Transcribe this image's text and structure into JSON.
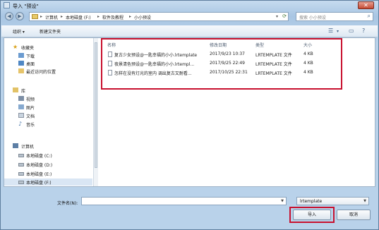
{
  "window": {
    "title": "导入 \"预设\"",
    "close_label": "✕"
  },
  "nav": {
    "back_icon": "back-arrow-icon",
    "forward_icon": "forward-arrow-icon",
    "breadcrumb": [
      "计算机",
      "本地磁盘 (F:)",
      "软件及教程",
      "小小预设"
    ],
    "search_placeholder": "搜索 小小预设"
  },
  "toolbar": {
    "organize_label": "组织 ▾",
    "new_folder_label": "新建文件夹"
  },
  "sidebar": {
    "favorites": {
      "header": "收藏夹",
      "items": [
        "下载",
        "桌面",
        "最近访问的位置"
      ]
    },
    "library": {
      "header": "库",
      "items": [
        "视频",
        "图片",
        "文档",
        "音乐"
      ]
    },
    "computer": {
      "header": "计算机",
      "items": [
        "本地磁盘 (C:)",
        "本地磁盘 (D:)",
        "本地磁盘 (E:)",
        "本地磁盘 (F:)"
      ]
    }
  },
  "file_list": {
    "columns": [
      "名称",
      "修改日期",
      "类型",
      "大小"
    ],
    "rows": [
      {
        "name": "复古少女预设@一匙幸福的小小.lrtemplate",
        "date": "2017/9/23 10:37",
        "type": "LRTEMPLATE 文件",
        "size": "4 KB"
      },
      {
        "name": "夜景清色预设@一匙幸福的小小.lrtempl...",
        "date": "2017/9/25 22:49",
        "type": "LRTEMPLATE 文件",
        "size": "4 KB"
      },
      {
        "name": "怎样在没有灯光的室内 调出复古又耐看...",
        "date": "2017/10/25 22:31",
        "type": "LRTEMPLATE 文件",
        "size": "4 KB"
      }
    ]
  },
  "footer": {
    "filename_label": "文件名(N):",
    "filename_value": "",
    "filetype_value": "lrtemplate",
    "import_label": "导入",
    "cancel_label": "取消"
  },
  "colors": {
    "highlight_box": "#c8102e",
    "window_frame": "#a9c6e3"
  }
}
